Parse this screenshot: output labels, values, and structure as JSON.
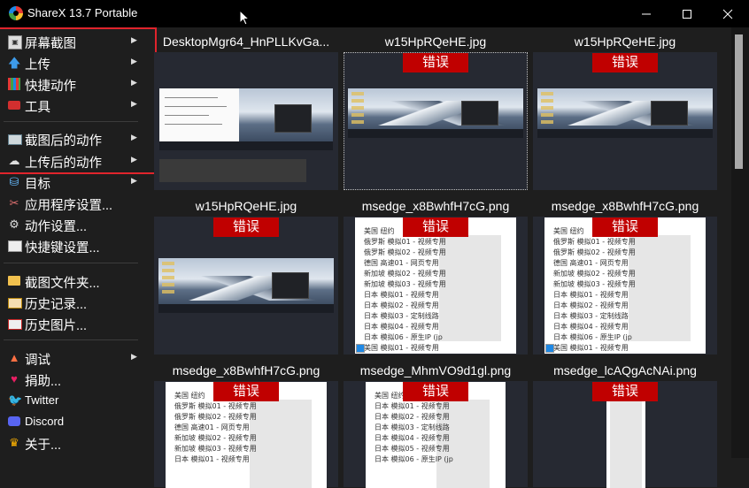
{
  "window": {
    "title": "ShareX 13.7 Portable",
    "minimize": "—",
    "maximize": "☐",
    "close": "✕"
  },
  "menu": {
    "items": [
      {
        "label": "屏幕截图",
        "icon": "screen-capture-icon",
        "submenu": true
      },
      {
        "label": "上传",
        "icon": "upload-icon",
        "submenu": true
      },
      {
        "label": "快捷动作",
        "icon": "workflows-icon",
        "submenu": true
      },
      {
        "label": "工具",
        "icon": "tools-icon",
        "submenu": true
      },
      {
        "label": "截图后的动作",
        "icon": "after-capture-icon",
        "submenu": true
      },
      {
        "label": "上传后的动作",
        "icon": "after-upload-icon",
        "submenu": true
      },
      {
        "label": "目标",
        "icon": "destinations-icon",
        "submenu": true
      },
      {
        "label": "应用程序设置...",
        "icon": "app-settings-icon",
        "submenu": false
      },
      {
        "label": "动作设置...",
        "icon": "task-settings-icon",
        "submenu": false
      },
      {
        "label": "快捷键设置...",
        "icon": "hotkey-settings-icon",
        "submenu": false
      },
      {
        "label": "截图文件夹...",
        "icon": "screenshots-folder-icon",
        "submenu": false
      },
      {
        "label": "历史记录...",
        "icon": "history-icon",
        "submenu": false
      },
      {
        "label": "历史图片...",
        "icon": "image-history-icon",
        "submenu": false
      },
      {
        "label": "调试",
        "icon": "debug-icon",
        "submenu": true
      },
      {
        "label": "捐助...",
        "icon": "donate-icon",
        "submenu": false
      },
      {
        "label": "Twitter",
        "icon": "twitter-icon",
        "submenu": false
      },
      {
        "label": "Discord",
        "icon": "discord-icon",
        "submenu": false
      },
      {
        "label": "关于...",
        "icon": "about-icon",
        "submenu": false
      }
    ]
  },
  "tiles": [
    {
      "name": "DesktopMgr64_HnPLLKvGa...",
      "error": "",
      "kind": "doc"
    },
    {
      "name": "w15HpRQeHE.jpg",
      "error": "错误",
      "kind": "desktop",
      "selected": true
    },
    {
      "name": "w15HpRQeHE.jpg",
      "error": "错误",
      "kind": "desktop"
    },
    {
      "name": "w15HpRQeHE.jpg",
      "error": "错误",
      "kind": "desktop"
    },
    {
      "name": "msedge_x8BwhfH7cG.png",
      "error": "错误",
      "kind": "list"
    },
    {
      "name": "msedge_x8BwhfH7cG.png",
      "error": "错误",
      "kind": "list"
    },
    {
      "name": "msedge_x8BwhfH7cG.png",
      "error": "错误",
      "kind": "list"
    },
    {
      "name": "msedge_MhmVO9d1gl.png",
      "error": "错误",
      "kind": "list"
    },
    {
      "name": "msedge_lcAQgAcNAi.png",
      "error": "错误",
      "kind": "list"
    }
  ],
  "list_rows": [
    "美国 纽约",
    "俄罗斯 模拟01 - 视频专用",
    "俄罗斯 模拟02 - 视频专用",
    "德国 高速01 - 网页专用",
    "新加坡 模拟02 - 视频专用",
    "新加坡 模拟03 - 视频专用",
    "日本 模拟01 - 视频专用",
    "日本 模拟02 - 视频专用",
    "日本 模拟03 - 定制线路",
    "日本 模拟04 - 视频专用",
    "日本 模拟05 - 视频专用",
    "日本 模拟06 - 原生IP (jp",
    "美国 模拟01 - 视频专用"
  ],
  "colors": {
    "accent_red": "#c00000",
    "highlight_border": "#e0242c",
    "background": "#1e1e1e",
    "card": "#262932"
  }
}
